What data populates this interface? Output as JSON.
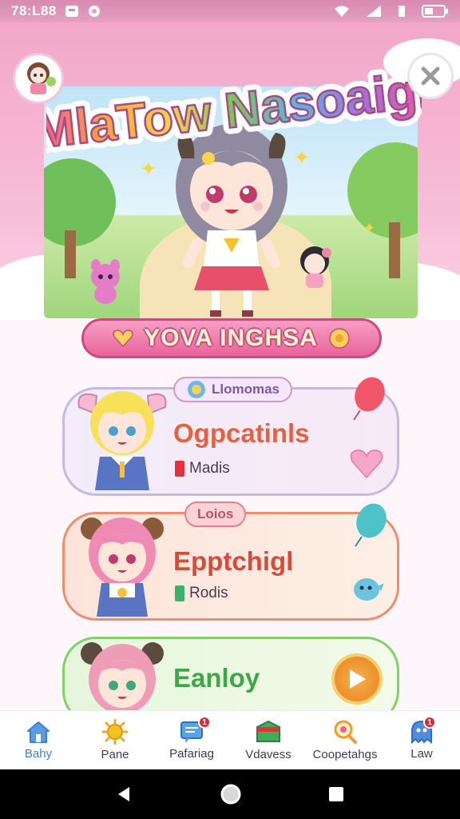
{
  "status_bar": {
    "time": "78:L88"
  },
  "hero": {
    "game_title": "MlaTow Nasoaigl",
    "title_colors": [
      "#f0559d",
      "#f7a23b",
      "#f6d24a",
      "#7cc657",
      "#5bb2e8",
      "#a56fd9",
      "#f0559d"
    ]
  },
  "banner": {
    "text": "YOVA INGHSA"
  },
  "cards": [
    {
      "tag": "Llomomas",
      "title": "Ogpcatinls",
      "subtitle": "Madis",
      "marker_color": "#e2323c"
    },
    {
      "tag": "Loios",
      "title": "Epptchigl",
      "subtitle": "Rodis",
      "marker_color": "#3fae6a"
    },
    {
      "title": "Eanloy"
    }
  ],
  "nav": {
    "items": [
      {
        "label": "Bahy",
        "icon": "home-icon",
        "active": true
      },
      {
        "label": "Pane",
        "icon": "sun-icon"
      },
      {
        "label": "Pafariag",
        "icon": "chat-icon",
        "badge": "1"
      },
      {
        "label": "Vdavess",
        "icon": "box-icon"
      },
      {
        "label": "Coopetahgs",
        "icon": "search-icon"
      },
      {
        "label": "Law",
        "icon": "ghost-icon",
        "badge": "1"
      }
    ]
  },
  "colors": {
    "accent": "#e8639a",
    "nav_active": "#3a7fd6"
  }
}
